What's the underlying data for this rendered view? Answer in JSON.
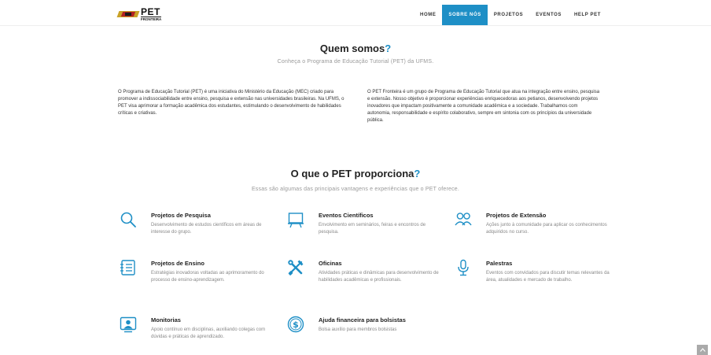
{
  "header": {
    "logo": {
      "title": "PET",
      "subtitle": "FRONTEIRA"
    },
    "nav": [
      {
        "label": "HOME"
      },
      {
        "label": "SOBRE NÓS"
      },
      {
        "label": "PROJETOS"
      },
      {
        "label": "EVENTOS"
      },
      {
        "label": "HELP PET"
      }
    ]
  },
  "about": {
    "title": "Quem somos",
    "title_mark": "?",
    "subtitle": "Conheça o Programa de Educação Tutorial (PET) da UFMS.",
    "left_text": "O Programa de Educação Tutorial (PET) é uma iniciativa do Ministério da Educação (MEC) criado para promover a indissociabilidade entre ensino, pesquisa e extensão nas universidades brasileiras. Na UFMS, o PET visa aprimorar a formação acadêmica dos estudantes, estimulando o desenvolvimento de habilidades críticas e criativas.",
    "right_text": "O PET Fronteira é um grupo de Programa de Educação Tutorial que atua na integração entre ensino, pesquisa e extensão. Nosso objetivo é proporcionar experiências enriquecedoras aos petianos, desenvolvendo projetos inovadores que impactam positivamente a comunidade acadêmica e a sociedade. Trabalhamos com autonomia, responsabilidade e espírito colaborativo, sempre em sintonia com os princípios da universidade pública."
  },
  "benefits": {
    "title": "O que o PET proporciona",
    "title_mark": "?",
    "subtitle": "Essas são algumas das principais vantagens e experiências que o PET oferece.",
    "items": [
      {
        "icon": "search-icon",
        "title": "Projetos de Pesquisa",
        "desc": "Desenvolvimento de estudos científicos em áreas de interesse do grupo."
      },
      {
        "icon": "presentation-board-icon",
        "title": "Eventos Científicos",
        "desc": "Envolvimento em seminários, feiras e encontros de pesquisa."
      },
      {
        "icon": "people-icon",
        "title": "Projetos de Extensão",
        "desc": "Ações junto à comunidade para aplicar os conhecimentos adquiridos no curso."
      },
      {
        "icon": "document-list-icon",
        "title": "Projetos de Ensino",
        "desc": "Estratégias inovadoras voltadas ao aprimoramento do processo de ensino-aprendizagem."
      },
      {
        "icon": "tools-icon",
        "title": "Oficinas",
        "desc": "Atividades práticas e dinâmicas para desenvolvimento de habilidades acadêmicas e profissionais."
      },
      {
        "icon": "microphone-icon",
        "title": "Palestras",
        "desc": "Eventos com convidados para discutir temas relevantes da área, atualidades e mercado de trabalho."
      },
      {
        "icon": "monitor-user-icon",
        "title": "Monitorias",
        "desc": "Apoio contínuo em disciplinas, auxiliando colegas com dúvidas e práticas de aprendizado."
      },
      {
        "icon": "dollar-coin-icon",
        "title": "Ajuda financeira para bolsistas",
        "desc": "Bolsa auxílio para membros bolsistas"
      }
    ]
  },
  "colors": {
    "accent": "#1e8fc6",
    "text": "#222222",
    "muted": "#888888"
  },
  "scroll_top": {
    "icon": "chevron-up-icon"
  }
}
